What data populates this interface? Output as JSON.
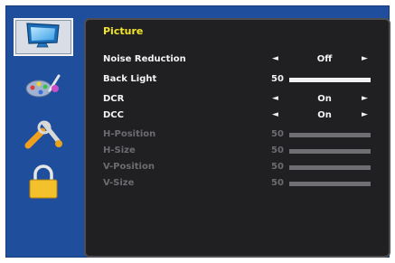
{
  "sidebar": {
    "items": [
      {
        "icon": "monitor-icon",
        "selected": true
      },
      {
        "icon": "color-palette-icon",
        "selected": false
      },
      {
        "icon": "tools-icon",
        "selected": false
      },
      {
        "icon": "lock-icon",
        "selected": false
      }
    ]
  },
  "menu": {
    "title": "Picture",
    "rows": [
      {
        "label": "Noise Reduction",
        "type": "option",
        "value": "Off",
        "enabled": true
      },
      {
        "label": "Back Light",
        "type": "slider",
        "value": "50",
        "level": 1.0,
        "enabled": true
      },
      {
        "label": "DCR",
        "type": "option",
        "value": "On",
        "enabled": true
      },
      {
        "label": "DCC",
        "type": "option",
        "value": "On",
        "enabled": true
      },
      {
        "label": "H-Position",
        "type": "slider",
        "value": "50",
        "level": 1.0,
        "enabled": false
      },
      {
        "label": "H-Size",
        "type": "slider",
        "value": "50",
        "level": 1.0,
        "enabled": false
      },
      {
        "label": "V-Position",
        "type": "slider",
        "value": "50",
        "level": 1.0,
        "enabled": false
      },
      {
        "label": "V-Size",
        "type": "slider",
        "value": "50",
        "level": 1.0,
        "enabled": false
      }
    ]
  },
  "colors": {
    "frame": "#1f4f9c",
    "panel": "#202023",
    "title": "#f2e52a",
    "active_text": "#f3f3f3",
    "disabled_text": "#6b6b70"
  },
  "glyphs": {
    "left_arrow": "◄",
    "right_arrow": "►"
  }
}
